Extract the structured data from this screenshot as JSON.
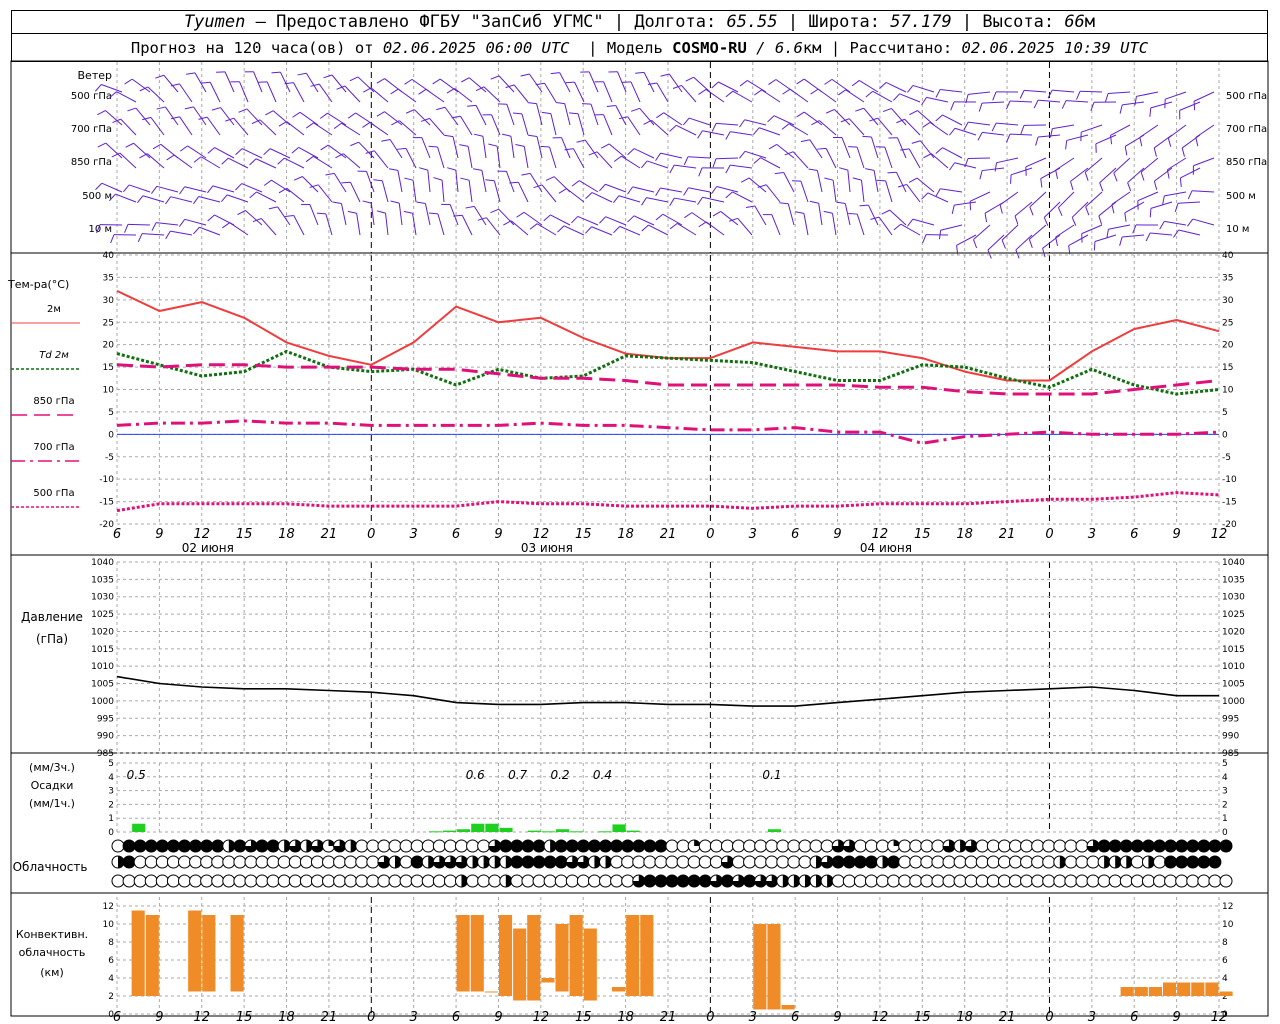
{
  "header": {
    "city": "Tyumen",
    "provider": "Предоставлено ФГБУ \"ЗапСиб УГМС\"",
    "lon_label": "Долгота:",
    "lon_value": "65.55",
    "lat_label": "Широта:",
    "lat_value": "57.179",
    "alt_label": "Высота:",
    "alt_value": "66",
    "alt_unit": "м",
    "forecast_prefix": "Прогноз на 120 часа(ов) от",
    "forecast_time": "02.06.2025 06:00 UTC",
    "model_label": "Модель",
    "model_name": "COSMO-RU",
    "model_res": "/ 6.6",
    "model_res_unit": "км",
    "computed_label": "Рассчитано:",
    "computed_time": "02.06.2025 10:39 UTC"
  },
  "colors": {
    "t2m": "#f03c3c",
    "td2m": "#107010",
    "t850": "#e0107a",
    "t700": "#e0107a",
    "t500": "#e0107a",
    "wind": "#6020d0",
    "zero": "#2040ff",
    "precip": "#20d020",
    "convective": "#f08c28",
    "pressure": "#000000"
  },
  "chart_data": {
    "type": "line",
    "x_hours": [
      6,
      9,
      12,
      15,
      18,
      21,
      0,
      3,
      6,
      9,
      12,
      15,
      18,
      21,
      0,
      3,
      6,
      9,
      12,
      15,
      18,
      21,
      0,
      3,
      6,
      9,
      12
    ],
    "day_labels": [
      {
        "label": "02 июня",
        "hour_index": 2
      },
      {
        "label": "03 июня",
        "hour_index": 10
      },
      {
        "label": "04 июня",
        "hour_index": 18
      }
    ],
    "wind": {
      "label": "Ветер",
      "levels": [
        "500 гПа",
        "700 гПа",
        "850 гПа",
        "500 м",
        "10  м"
      ]
    },
    "temperature": {
      "label": "Тем-ра(°C)",
      "ylim": [
        -20,
        40
      ],
      "yticks": [
        -20,
        -15,
        -10,
        -5,
        0,
        5,
        10,
        15,
        20,
        25,
        30,
        35,
        40
      ],
      "series": [
        {
          "name": "2м",
          "key": "t2m",
          "values": [
            32,
            27.5,
            29.5,
            26,
            20.5,
            17.5,
            15.5,
            20.5,
            28.5,
            25,
            26,
            21.5,
            18,
            17,
            17,
            20.5,
            19.5,
            18.5,
            18.5,
            17,
            14,
            12,
            12,
            18.5,
            23.5,
            25.5,
            23
          ]
        },
        {
          "name": "Td 2м",
          "key": "td2m",
          "values": [
            18,
            15.5,
            13,
            14,
            18.5,
            15,
            14,
            14.5,
            11,
            14.5,
            12.5,
            13,
            17.5,
            17,
            16.5,
            16,
            14,
            12,
            12,
            15.5,
            15,
            12.5,
            10.5,
            14.5,
            11,
            9,
            10
          ]
        },
        {
          "name": "850 гПа",
          "key": "t850",
          "values": [
            15.5,
            15,
            15.5,
            15.5,
            15,
            15,
            15,
            14.5,
            14.5,
            13.5,
            12.5,
            12.5,
            12,
            11,
            11,
            11,
            11,
            11,
            10.5,
            10.5,
            9.5,
            9,
            9,
            9,
            10,
            11,
            12
          ]
        },
        {
          "name": "700 гПа",
          "key": "t700",
          "values": [
            2,
            2.5,
            2.5,
            3,
            2.5,
            2.5,
            2,
            2,
            2,
            2,
            2.5,
            2,
            2,
            1.5,
            1,
            1,
            1.5,
            0.5,
            0.5,
            -2,
            -0.5,
            0,
            0.5,
            0,
            0,
            0,
            0.5
          ]
        },
        {
          "name": "500 гПа",
          "key": "t500",
          "values": [
            -17,
            -15.5,
            -15.5,
            -15.5,
            -15.5,
            -16,
            -16,
            -16,
            -16,
            -15,
            -15.5,
            -15.5,
            -16,
            -16,
            -16,
            -16.5,
            -16,
            -16,
            -15.5,
            -15.5,
            -15.5,
            -15,
            -14.5,
            -14.5,
            -14,
            -13,
            -13.5
          ]
        }
      ]
    },
    "pressure": {
      "label_1": "Давление",
      "label_2": "(гПа)",
      "ylim": [
        985,
        1040
      ],
      "yticks": [
        985,
        990,
        995,
        1000,
        1005,
        1010,
        1015,
        1020,
        1025,
        1030,
        1035,
        1040
      ],
      "values": [
        1007,
        1005,
        1004,
        1003.5,
        1003.5,
        1003,
        1002.5,
        1001.5,
        999.5,
        999,
        999,
        999.5,
        999.5,
        999,
        999,
        998.5,
        998.5,
        999.5,
        1000.5,
        1001.5,
        1002.5,
        1003,
        1003.5,
        1004,
        1003,
        1001.5,
        1001.5
      ]
    },
    "precip": {
      "label_1": "(мм/3ч.)",
      "label_2": "Осадки",
      "label_3": "(мм/1ч.)",
      "ylim": [
        0,
        5
      ],
      "yticks": [
        0,
        1,
        2,
        3,
        4,
        5
      ],
      "annotations": [
        {
          "hour_index": 0.5,
          "text": "0.5"
        },
        {
          "hour_index": 8.5,
          "text": "0.6"
        },
        {
          "hour_index": 9.5,
          "text": "0.7"
        },
        {
          "hour_index": 10.5,
          "text": "0.2"
        },
        {
          "hour_index": 11.5,
          "text": "0.4"
        },
        {
          "hour_index": 15.5,
          "text": "0.1"
        }
      ],
      "bars": [
        {
          "t": 1,
          "v": 0.6
        },
        {
          "t": 22,
          "v": 0.05
        },
        {
          "t": 23,
          "v": 0.1
        },
        {
          "t": 24,
          "v": 0.2
        },
        {
          "t": 25,
          "v": 0.6
        },
        {
          "t": 26,
          "v": 0.6
        },
        {
          "t": 27,
          "v": 0.3
        },
        {
          "t": 29,
          "v": 0.1
        },
        {
          "t": 30,
          "v": 0.05
        },
        {
          "t": 31,
          "v": 0.2
        },
        {
          "t": 32,
          "v": 0.05
        },
        {
          "t": 34,
          "v": 0.05
        },
        {
          "t": 35,
          "v": 0.55
        },
        {
          "t": 36,
          "v": 0.1
        },
        {
          "t": 46,
          "v": 0.2
        }
      ]
    },
    "clouds": {
      "label": "Облачность",
      "rows": [
        [
          0,
          8,
          8,
          8,
          8,
          8,
          8,
          8,
          8,
          8,
          4,
          8,
          6,
          8,
          8,
          4,
          6,
          4,
          6,
          2,
          6,
          4,
          0,
          0,
          0,
          0,
          0,
          0,
          0,
          0,
          0,
          0,
          0,
          0,
          6,
          8,
          8,
          8,
          8,
          4,
          8,
          8,
          8,
          8,
          8,
          8,
          8,
          8,
          8,
          8,
          0,
          0,
          2,
          0,
          0,
          0,
          0,
          0,
          0,
          0,
          0,
          0,
          0,
          0,
          0,
          6,
          6,
          0,
          0,
          0,
          2,
          0,
          0,
          0,
          0,
          6,
          4,
          6,
          0,
          0,
          0,
          0,
          0,
          0,
          0,
          0,
          0,
          0,
          6,
          8,
          8,
          8,
          8,
          8,
          8,
          8,
          8,
          8,
          8,
          8,
          8
        ],
        [
          4,
          8,
          0,
          0,
          0,
          0,
          0,
          0,
          0,
          0,
          0,
          0,
          0,
          0,
          0,
          0,
          0,
          0,
          0,
          0,
          0,
          0,
          0,
          0,
          6,
          4,
          0,
          8,
          4,
          6,
          6,
          6,
          4,
          4,
          4,
          4,
          8,
          8,
          8,
          8,
          8,
          6,
          6,
          4,
          4,
          0,
          0,
          0,
          0,
          0,
          0,
          0,
          0,
          0,
          0,
          6,
          0,
          0,
          0,
          0,
          0,
          0,
          0,
          4,
          6,
          8,
          8,
          8,
          8,
          4,
          8,
          0,
          0,
          0,
          0,
          0,
          0,
          0,
          0,
          0,
          0,
          0,
          0,
          0,
          0,
          4,
          0,
          0,
          0,
          4,
          4,
          4,
          0,
          4,
          0,
          8,
          8,
          8,
          8,
          8
        ],
        [
          0,
          0,
          0,
          0,
          0,
          0,
          0,
          0,
          0,
          0,
          0,
          0,
          0,
          0,
          0,
          0,
          0,
          0,
          0,
          0,
          0,
          0,
          0,
          0,
          0,
          0,
          0,
          0,
          0,
          0,
          0,
          4,
          0,
          0,
          0,
          4,
          0,
          0,
          0,
          0,
          0,
          0,
          0,
          0,
          0,
          0,
          0,
          6,
          8,
          8,
          8,
          8,
          8,
          8,
          6,
          8,
          6,
          8,
          6,
          6,
          4,
          4,
          4,
          4,
          4,
          0,
          0,
          0,
          0,
          0,
          0,
          0,
          0,
          0,
          0,
          0,
          0,
          0,
          0,
          0,
          0,
          0,
          0,
          0,
          0,
          0,
          0,
          0,
          0,
          0,
          0,
          0,
          0,
          0,
          0,
          0,
          0,
          0,
          0,
          0,
          0
        ]
      ]
    },
    "convective": {
      "label_1": "Конвективн.",
      "label_2": "облачность",
      "label_3": "(км)",
      "ylim": [
        0,
        13
      ],
      "yticks": [
        0,
        2,
        4,
        6,
        8,
        10,
        12
      ],
      "bars": [
        {
          "t0": 1,
          "t1": 2,
          "b": 2,
          "top": 11.5
        },
        {
          "t0": 2,
          "t1": 3,
          "b": 2,
          "top": 11
        },
        {
          "t0": 5,
          "t1": 6,
          "b": 2.5,
          "top": 11.5
        },
        {
          "t0": 6,
          "t1": 7,
          "b": 2.5,
          "top": 11
        },
        {
          "t0": 8,
          "t1": 9,
          "b": 2.5,
          "top": 11
        },
        {
          "t0": 24,
          "t1": 25,
          "b": 2.5,
          "top": 11
        },
        {
          "t0": 25,
          "t1": 26,
          "b": 2.5,
          "top": 11
        },
        {
          "t0": 26,
          "t1": 27,
          "b": 2.5,
          "top": 2.5
        },
        {
          "t0": 27,
          "t1": 28,
          "b": 2,
          "top": 11
        },
        {
          "t0": 28,
          "t1": 29,
          "b": 1.5,
          "top": 9.5
        },
        {
          "t0": 29,
          "t1": 30,
          "b": 1.5,
          "top": 11
        },
        {
          "t0": 30,
          "t1": 31,
          "b": 3.5,
          "top": 4
        },
        {
          "t0": 31,
          "t1": 32,
          "b": 2.5,
          "top": 10
        },
        {
          "t0": 32,
          "t1": 33,
          "b": 2,
          "top": 11
        },
        {
          "t0": 33,
          "t1": 34,
          "b": 1.5,
          "top": 9.5
        },
        {
          "t0": 35,
          "t1": 36,
          "b": 2.5,
          "top": 3
        },
        {
          "t0": 36,
          "t1": 37,
          "b": 2,
          "top": 11
        },
        {
          "t0": 37,
          "t1": 38,
          "b": 2,
          "top": 11
        },
        {
          "t0": 45,
          "t1": 46,
          "b": 0.5,
          "top": 10
        },
        {
          "t0": 46,
          "t1": 47,
          "b": 0.5,
          "top": 10
        },
        {
          "t0": 47,
          "t1": 48,
          "b": 0.5,
          "top": 1
        },
        {
          "t0": 71,
          "t1": 72,
          "b": 2,
          "top": 3
        },
        {
          "t0": 72,
          "t1": 73,
          "b": 2,
          "top": 3
        },
        {
          "t0": 73,
          "t1": 74,
          "b": 2,
          "top": 3
        },
        {
          "t0": 74,
          "t1": 75,
          "b": 2,
          "top": 3.5
        },
        {
          "t0": 75,
          "t1": 76,
          "b": 2,
          "top": 3.5
        },
        {
          "t0": 76,
          "t1": 77,
          "b": 2,
          "top": 3.5
        },
        {
          "t0": 77,
          "t1": 78,
          "b": 2,
          "top": 3.5
        },
        {
          "t0": 78,
          "t1": 79,
          "b": 2,
          "top": 2.5
        }
      ]
    }
  }
}
